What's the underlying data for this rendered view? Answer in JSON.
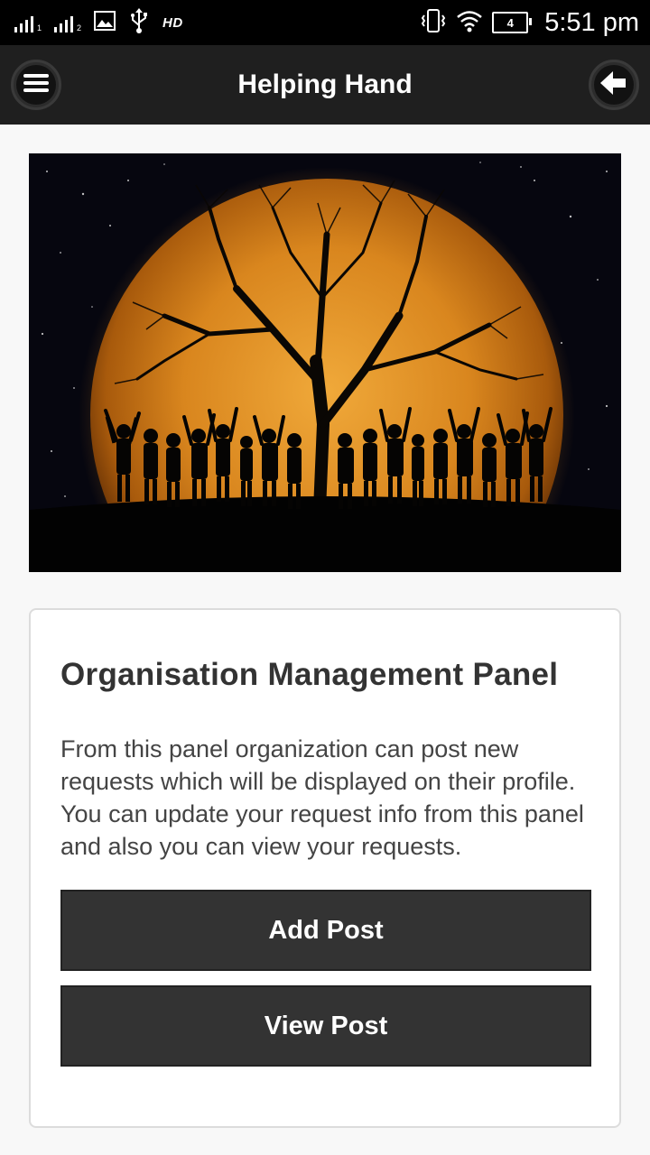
{
  "status_bar": {
    "sim1_label": "1",
    "sim2_label": "2",
    "network_label": "HD",
    "battery_level": "4",
    "time": "5:51 pm"
  },
  "app_bar": {
    "title": "Helping Hand",
    "menu_icon": "hamburger-menu-icon",
    "back_icon": "arrow-left-icon"
  },
  "hero": {
    "description_icon": "moon-tree-children-image"
  },
  "panel": {
    "title": "Organisation Management Panel",
    "description": "From this panel organization can post new requests which will be displayed on their profile. You can update your request info from this panel and also you can view your requests.",
    "add_post_label": "Add Post",
    "view_post_label": "View Post"
  },
  "colors": {
    "status_bar_bg": "#000000",
    "app_bar_bg": "#1f1f1f",
    "button_bg": "#333333",
    "page_bg": "#f8f8f8"
  }
}
